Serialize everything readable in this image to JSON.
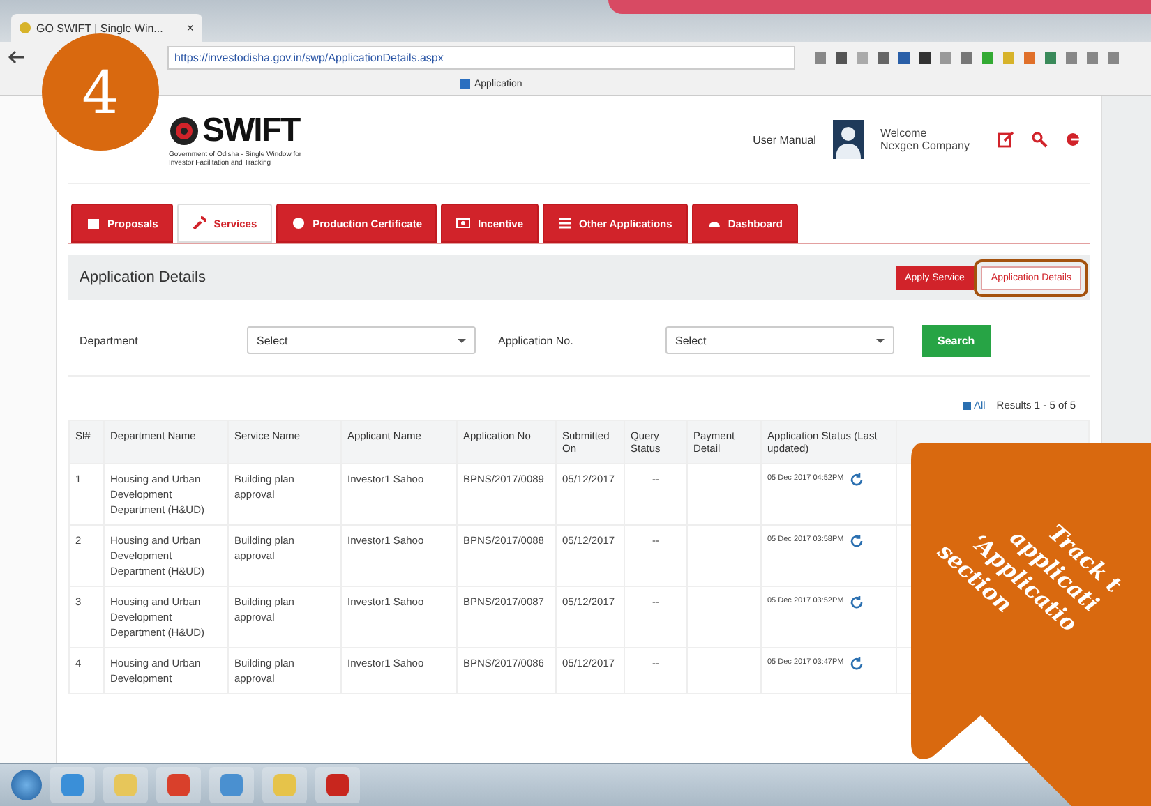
{
  "browser": {
    "tab_title": "GO SWIFT | Single Win...",
    "tab_close": "×",
    "url": "https://investodisha.gov.in/swp/ApplicationDetails.aspx",
    "bookmarks": [
      {
        "label": "Application"
      }
    ]
  },
  "step_badge": "4",
  "header": {
    "logo_title": "SWIFT",
    "logo_subtitle": "Government of Odisha - Single Window for Investor Facilitation and Tracking",
    "user_manual": "User Manual",
    "welcome": "Welcome",
    "company": "Nexgen Company"
  },
  "tabs": [
    {
      "label": "Proposals",
      "selected": false
    },
    {
      "label": "Services",
      "selected": true
    },
    {
      "label": "Production Certificate",
      "selected": false
    },
    {
      "label": "Incentive",
      "selected": false
    },
    {
      "label": "Other Applications",
      "selected": false
    },
    {
      "label": "Dashboard",
      "selected": false
    }
  ],
  "panel": {
    "title": "Application Details",
    "buttons": [
      {
        "label": "Apply Service",
        "selected": false
      },
      {
        "label": "Application Details",
        "selected": true,
        "highlighted": true
      }
    ]
  },
  "filters": {
    "department_label": "Department",
    "department_value": "Select",
    "application_label": "Application No.",
    "application_value": "Select",
    "search": "Search"
  },
  "results": {
    "all": "All",
    "count": "Results 1 - 5 of 5"
  },
  "table": {
    "columns": [
      "Sl#",
      "Department Name",
      "Service Name",
      "Applicant Name",
      "Application No",
      "Submitted On",
      "Query Status",
      "Payment Detail",
      "Application Status (Last updated)"
    ],
    "rows": [
      {
        "sl": "1",
        "department": "Housing and Urban Development Department (H&UD)",
        "service": "Building plan approval",
        "applicant": "Investor1 Sahoo",
        "application_no": "BPNS/2017/0089",
        "submitted": "05/12/2017",
        "query": "--",
        "payment": "",
        "status": "05 Dec 2017 04:52PM"
      },
      {
        "sl": "2",
        "department": "Housing and Urban Development Department (H&UD)",
        "service": "Building plan approval",
        "applicant": "Investor1 Sahoo",
        "application_no": "BPNS/2017/0088",
        "submitted": "05/12/2017",
        "query": "--",
        "payment": "",
        "status": "05 Dec 2017 03:58PM"
      },
      {
        "sl": "3",
        "department": "Housing and Urban Development Department (H&UD)",
        "service": "Building plan approval",
        "applicant": "Investor1 Sahoo",
        "application_no": "BPNS/2017/0087",
        "submitted": "05/12/2017",
        "query": "--",
        "payment": "",
        "status": "05 Dec 2017 03:52PM"
      },
      {
        "sl": "4",
        "department": "Housing and Urban Development",
        "service": "Building plan approval",
        "applicant": "Investor1 Sahoo",
        "application_no": "BPNS/2017/0086",
        "submitted": "05/12/2017",
        "query": "--",
        "payment": "",
        "status": "05 Dec 2017 03:47PM"
      }
    ]
  },
  "callout": {
    "lines": [
      "Track t",
      "applicati",
      "‘Applicatio",
      "section"
    ]
  },
  "taskbar": {
    "apps": [
      {
        "kind": "ie"
      },
      {
        "kind": "paint"
      },
      {
        "kind": "chrome"
      },
      {
        "kind": "globe"
      },
      {
        "kind": "folder"
      },
      {
        "kind": "pdf"
      }
    ]
  }
}
